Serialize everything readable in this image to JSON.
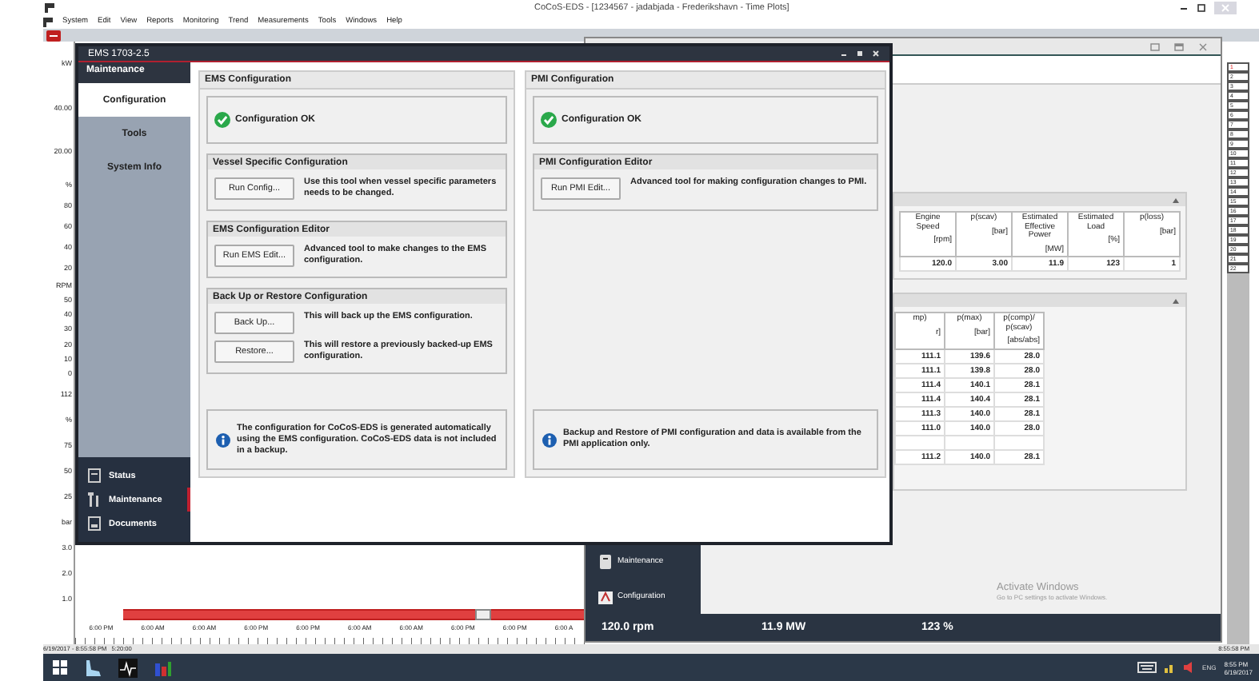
{
  "window": {
    "title": "CoCoS-EDS - [1234567 - jadabjada - Frederikshavn - Time Plots]"
  },
  "menu": [
    "System",
    "Edit",
    "View",
    "Reports",
    "Monitoring",
    "Trend",
    "Measurements",
    "Tools",
    "Windows",
    "Help"
  ],
  "axis_groups": [
    [
      "kW",
      "40.00",
      "20.00"
    ],
    [
      "%",
      "80",
      "60",
      "40",
      "20"
    ],
    [
      "RPM",
      "50",
      "40",
      "30",
      "20",
      "10",
      "0"
    ],
    [
      "112",
      "%",
      "75",
      "50",
      "25"
    ],
    [
      "bar",
      "3.0",
      "2.0",
      "1.0"
    ]
  ],
  "time_axis": [
    "6:00 PM",
    "6:00 AM",
    "6:00 AM",
    "6:00 PM",
    "6:00 PM",
    "6:00 AM",
    "6:00 AM",
    "6:00 PM",
    "6:00 PM",
    "6:00 A"
  ],
  "status_line": {
    "date": "6/19/2017 - 8:55:58 PM",
    "span": "5:20:00",
    "time": "8:55:58 PM"
  },
  "dialog": {
    "title": "EMS 1703-2.5",
    "sidebar": {
      "header": "Maintenance",
      "items": [
        {
          "label": "Configuration",
          "selected": true
        },
        {
          "label": "Tools",
          "selected": false
        },
        {
          "label": "System Info",
          "selected": false
        }
      ]
    },
    "nav": [
      {
        "label": "Status",
        "selected": false
      },
      {
        "label": "Maintenance",
        "selected": true
      },
      {
        "label": "Documents",
        "selected": false
      }
    ],
    "columns": [
      {
        "title": "EMS Configuration",
        "status": "Configuration OK",
        "sections": [
          {
            "title": "Vessel Specific Configuration",
            "rows": [
              {
                "button": "Run Config...",
                "text": "Use this tool when vessel specific parameters needs to be changed."
              }
            ]
          },
          {
            "title": "EMS Configuration Editor",
            "rows": [
              {
                "button": "Run EMS Edit...",
                "text": "Advanced tool to make changes to the EMS configuration."
              }
            ]
          },
          {
            "title": "Back Up or Restore Configuration",
            "rows": [
              {
                "button": "Back Up...",
                "text": "This will back up the EMS configuration."
              },
              {
                "button": "Restore...",
                "text": "This will restore a previously backed-up EMS configuration."
              }
            ]
          }
        ],
        "info": "The configuration for CoCoS-EDS is generated automatically using the EMS configuration. CoCoS-EDS data is not included in a backup."
      },
      {
        "title": "PMI Configuration",
        "status": "Configuration OK",
        "sections": [
          {
            "title": "PMI Configuration Editor",
            "rows": [
              {
                "button": "Run PMI Edit...",
                "text": "Advanced tool for making configuration changes to PMI."
              }
            ]
          }
        ],
        "info": "Backup and Restore of PMI configuration and data is available from the PMI application only."
      }
    ]
  },
  "monitor": {
    "table1": {
      "columns": [
        {
          "name": "Engine Speed",
          "unit": "[rpm]"
        },
        {
          "name": "p(scav)",
          "unit": "[bar]"
        },
        {
          "name": "Estimated Effective Power",
          "unit": "[MW]"
        },
        {
          "name": "Estimated Load",
          "unit": "[%]"
        },
        {
          "name": "p(loss)",
          "unit": "[bar]"
        }
      ],
      "rows": [
        [
          "120.0",
          "3.00",
          "11.9",
          "123",
          "1"
        ]
      ]
    },
    "table2": {
      "columns": [
        {
          "name": "mp)",
          "unit": "r]"
        },
        {
          "name": "p(max)",
          "unit": "[bar]"
        },
        {
          "name": "p(comp)/ p(scav)",
          "unit": "[abs/abs]"
        }
      ],
      "rows": [
        {
          "kind": "data",
          "cells": [
            "111.1",
            "139.6",
            "28.0"
          ]
        },
        {
          "kind": "data",
          "cells": [
            "111.1",
            "139.8",
            "28.0"
          ]
        },
        {
          "kind": "data",
          "cells": [
            "111.4",
            "140.1",
            "28.1"
          ]
        },
        {
          "kind": "data",
          "cells": [
            "111.4",
            "140.4",
            "28.1"
          ]
        },
        {
          "kind": "data",
          "cells": [
            "111.3",
            "140.0",
            "28.1"
          ]
        },
        {
          "kind": "data",
          "cells": [
            "111.0",
            "140.0",
            "28.0"
          ]
        },
        {
          "kind": "spacer"
        },
        {
          "kind": "data",
          "cells": [
            "111.2",
            "140.0",
            "28.1"
          ]
        }
      ]
    },
    "nav": [
      "Maintenance",
      "Configuration"
    ],
    "readings": [
      "120.0 rpm",
      "11.9 MW",
      "123 %"
    ]
  },
  "channels": [
    {
      "label": "1",
      "selected": true
    },
    {
      "label": "2",
      "selected": false
    },
    {
      "label": "3",
      "selected": false
    },
    {
      "label": "4",
      "selected": false
    },
    {
      "label": "5",
      "selected": false
    },
    {
      "label": "6",
      "selected": false
    },
    {
      "label": "7",
      "selected": false
    },
    {
      "label": "8",
      "selected": false
    },
    {
      "label": "9",
      "selected": false
    },
    {
      "label": "10",
      "selected": false
    },
    {
      "label": "11",
      "selected": false
    },
    {
      "label": "12",
      "selected": false
    },
    {
      "label": "13",
      "selected": false
    },
    {
      "label": "14",
      "selected": false
    },
    {
      "label": "15",
      "selected": false
    },
    {
      "label": "16",
      "selected": false
    },
    {
      "label": "17",
      "selected": false
    },
    {
      "label": "18",
      "selected": false
    },
    {
      "label": "19",
      "selected": false
    },
    {
      "label": "20",
      "selected": false
    },
    {
      "label": "21",
      "selected": false
    },
    {
      "label": "22",
      "selected": false
    }
  ],
  "activation": {
    "title": "Activate Windows",
    "text": "Go to PC settings to activate Windows."
  },
  "taskbar": {
    "language": "ENG",
    "time": "8:55 PM",
    "date": "6/19/2017"
  }
}
